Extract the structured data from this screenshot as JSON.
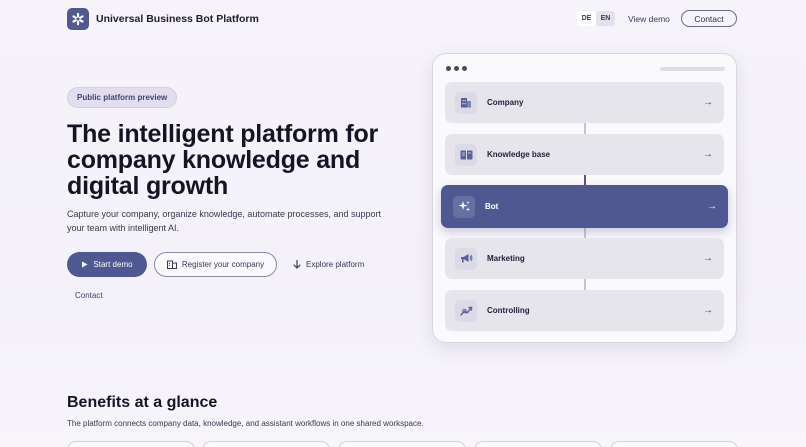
{
  "header": {
    "brand_name": "Universal Business Bot Platform",
    "lang_de": "DE",
    "lang_en": "EN",
    "view_demo": "View demo",
    "contact": "Contact"
  },
  "hero": {
    "badge": "Public platform preview",
    "title": "The intelligent platform for company knowledge and digital growth",
    "subtitle": "Capture your company, organize knowledge, automate processes, and support your team with intelligent AI.",
    "start_demo": "Start demo",
    "register": "Register your company",
    "explore": "Explore platform",
    "contact": "Contact"
  },
  "flow": {
    "steps": [
      {
        "label": "Company",
        "icon": "building-icon"
      },
      {
        "label": "Knowledge base",
        "icon": "book-icon"
      },
      {
        "label": "Bot",
        "icon": "sparkle-icon",
        "active": true
      },
      {
        "label": "Marketing",
        "icon": "megaphone-icon"
      },
      {
        "label": "Controlling",
        "icon": "chart-icon"
      }
    ]
  },
  "benefits": {
    "title": "Benefits at a glance",
    "subtitle": "The platform connects company data, knowledge, and assistant workflows in one shared workspace."
  },
  "colors": {
    "accent": "#4f5890",
    "background": "#f5f2fa"
  }
}
